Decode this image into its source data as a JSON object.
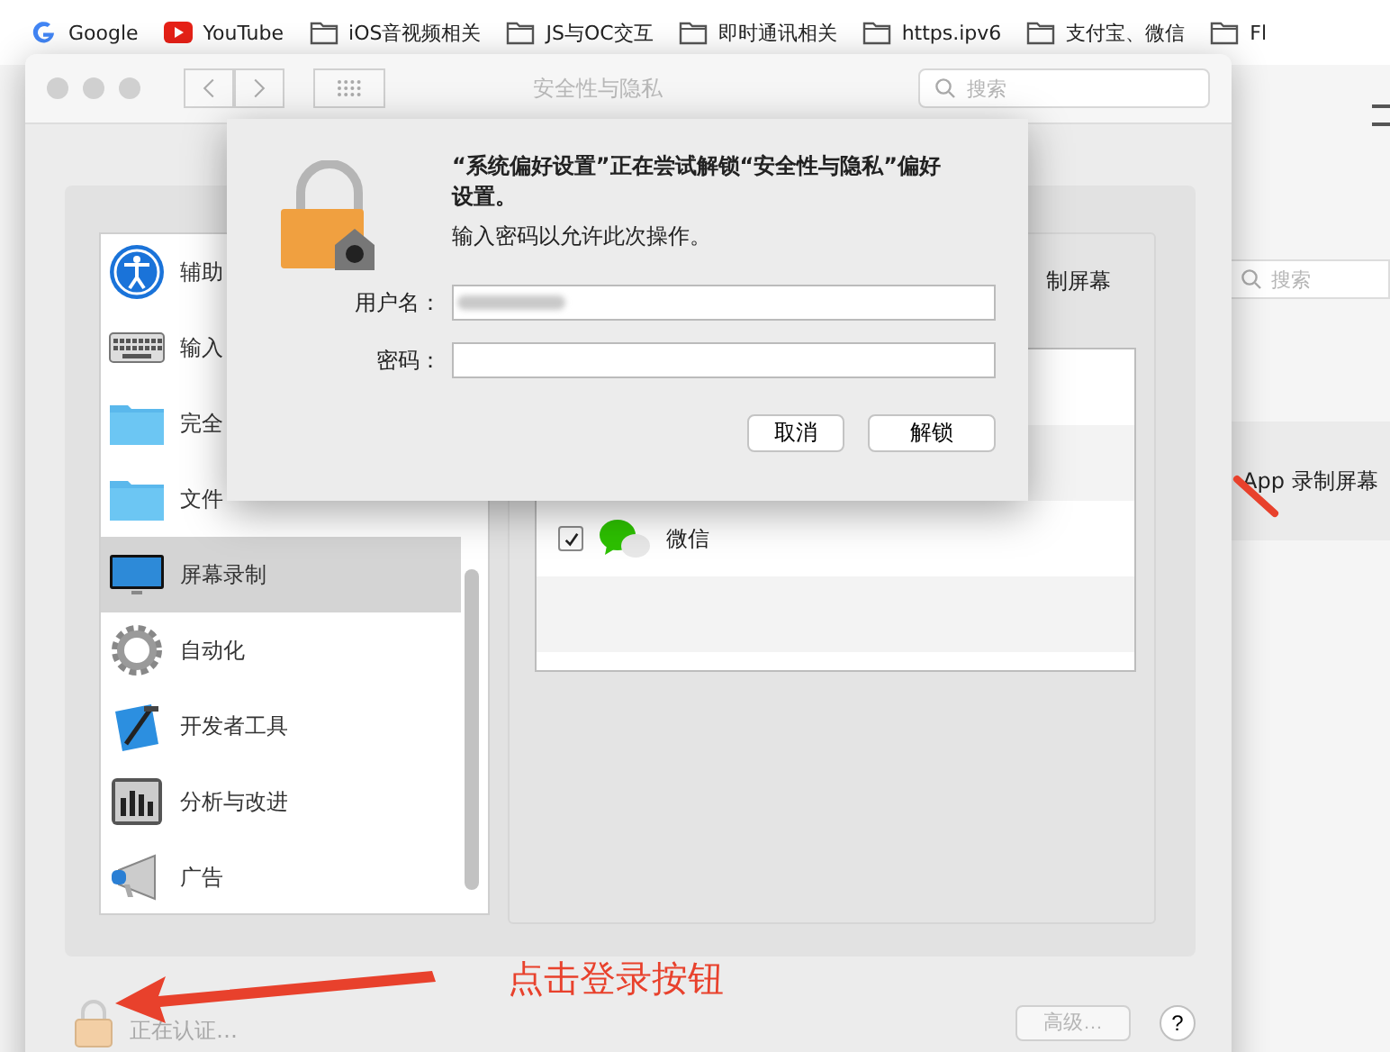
{
  "bookmarks": [
    {
      "label": "Google",
      "kind": "google"
    },
    {
      "label": "YouTube",
      "kind": "youtube"
    },
    {
      "label": "iOS音视频相关",
      "kind": "folder"
    },
    {
      "label": "JS与OC交互",
      "kind": "folder"
    },
    {
      "label": "即时通讯相关",
      "kind": "folder"
    },
    {
      "label": "https.ipv6",
      "kind": "folder"
    },
    {
      "label": "支付宝、微信",
      "kind": "folder"
    },
    {
      "label": "Fl",
      "kind": "folder"
    }
  ],
  "background_page": {
    "search": {
      "placeholder": "搜索"
    },
    "row_text": "App 录制屏幕"
  },
  "window": {
    "title": "安全性与隐私",
    "search": {
      "placeholder": "搜索"
    },
    "sidebar": {
      "items": [
        {
          "label": "辅助",
          "kind": "accessibility",
          "selected": false
        },
        {
          "label": "输入",
          "kind": "keyboard",
          "selected": false
        },
        {
          "label": "完全",
          "kind": "folder",
          "selected": false
        },
        {
          "label": "文件",
          "kind": "folder",
          "selected": false
        },
        {
          "label": "屏幕录制",
          "kind": "display",
          "selected": true
        },
        {
          "label": "自动化",
          "kind": "gear",
          "selected": false
        },
        {
          "label": "开发者工具",
          "kind": "hammer",
          "selected": false
        },
        {
          "label": "分析与改进",
          "kind": "chart",
          "selected": false
        },
        {
          "label": "广告",
          "kind": "megaphone",
          "selected": false
        }
      ]
    },
    "pane": {
      "heading": "制屏幕",
      "apps": [
        {
          "name": "微信",
          "checked": true
        }
      ]
    },
    "lock_text": "正在认证…",
    "advanced_button": {
      "label": "高级…",
      "disabled": true
    },
    "help_button": "?"
  },
  "dialog": {
    "message": "“系统偏好设置”正在尝试解锁“安全性与隐私”偏好设置。",
    "note": "输入密码以允许此次操作。",
    "fields": [
      {
        "label": "用户名：",
        "redacted": true
      },
      {
        "label": "密码：",
        "redacted": false
      }
    ],
    "buttons": [
      {
        "label": "取消",
        "default": false
      },
      {
        "label": "解锁",
        "default": false
      }
    ]
  },
  "annotation": {
    "text": "点击登录按钮"
  }
}
